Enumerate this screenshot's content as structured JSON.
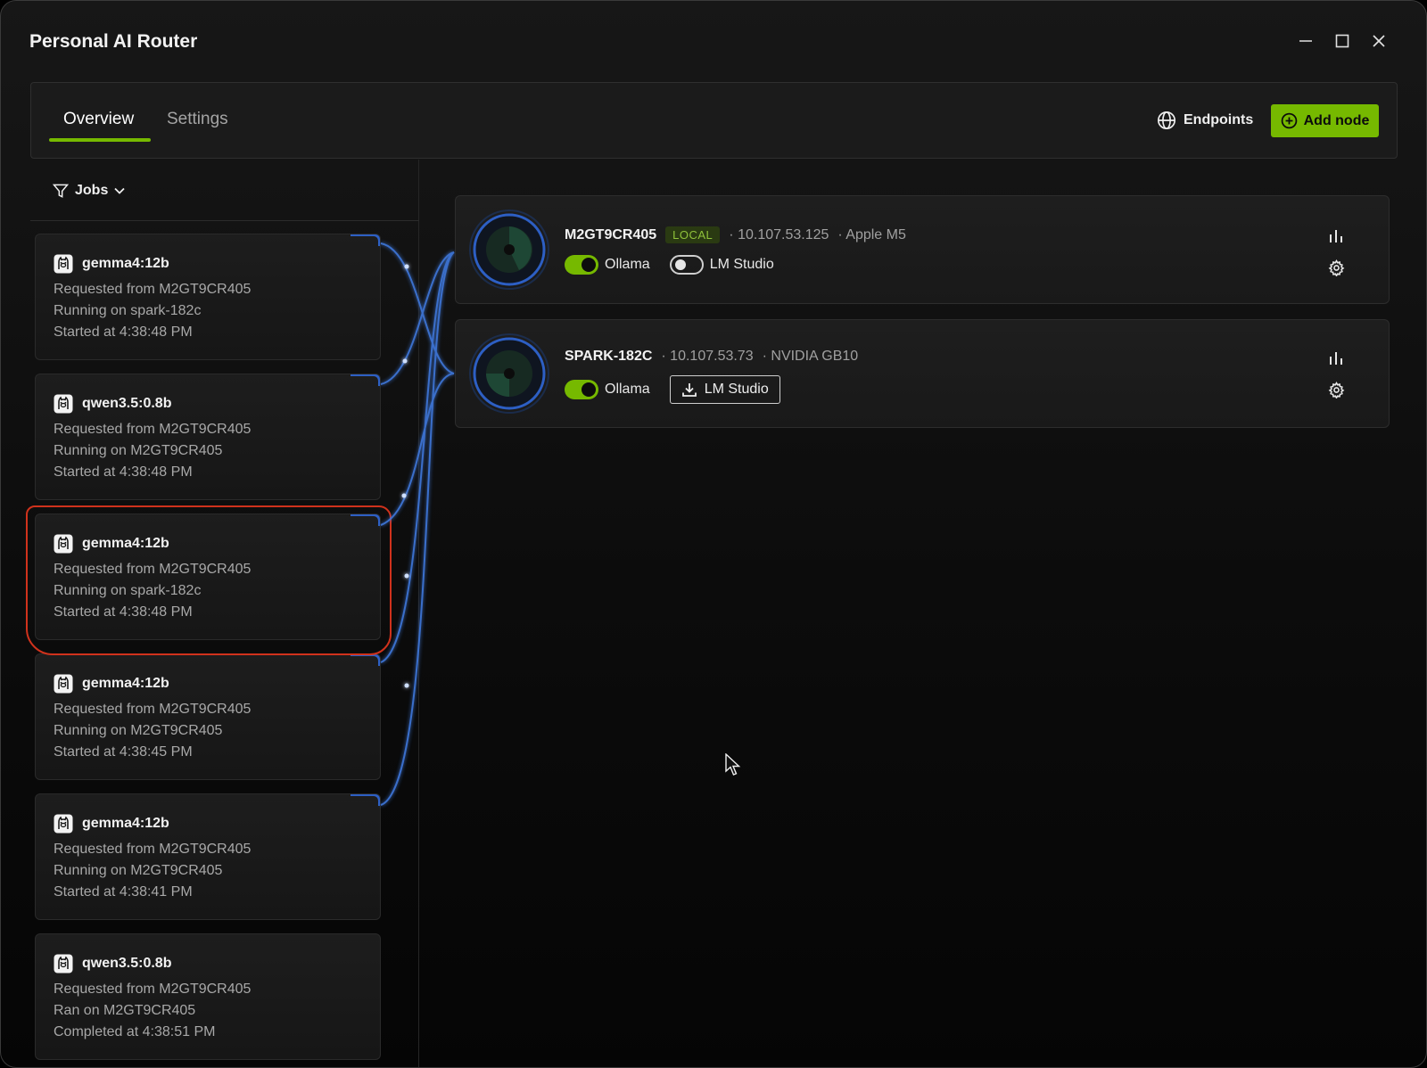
{
  "app": {
    "title": "Personal AI Router"
  },
  "window_controls": {
    "minimize": "minimize-icon",
    "maximize": "maximize-icon",
    "close": "close-icon"
  },
  "tabs": [
    {
      "label": "Overview",
      "active": true
    },
    {
      "label": "Settings",
      "active": false
    }
  ],
  "toolbar": {
    "endpoints_label": "Endpoints",
    "add_node_label": "Add node"
  },
  "jobs_filter": {
    "label": "Jobs"
  },
  "jobs": [
    {
      "model": "gemma4:12b",
      "requested": "Requested from M2GT9CR405",
      "running": "Running on spark-182c",
      "time": "Started at 4:38:48 PM"
    },
    {
      "model": "qwen3.5:0.8b",
      "requested": "Requested from M2GT9CR405",
      "running": "Running on M2GT9CR405",
      "time": "Started at 4:38:48 PM"
    },
    {
      "model": "gemma4:12b",
      "requested": "Requested from M2GT9CR405",
      "running": "Running on spark-182c",
      "time": "Started at 4:38:48 PM"
    },
    {
      "model": "gemma4:12b",
      "requested": "Requested from M2GT9CR405",
      "running": "Running on M2GT9CR405",
      "time": "Started at 4:38:45 PM"
    },
    {
      "model": "gemma4:12b",
      "requested": "Requested from M2GT9CR405",
      "running": "Running on M2GT9CR405",
      "time": "Started at 4:38:41 PM"
    },
    {
      "model": "qwen3.5:0.8b",
      "requested": "Requested from M2GT9CR405",
      "running": "Ran on M2GT9CR405",
      "time": "Completed at 4:38:51 PM"
    }
  ],
  "nodes": [
    {
      "name": "M2GT9CR405",
      "badge": "LOCAL",
      "ip": "· 10.107.53.125",
      "hw": "· Apple M5",
      "services": [
        {
          "label": "Ollama",
          "state": "on"
        },
        {
          "label": "LM Studio",
          "state": "off"
        }
      ]
    },
    {
      "name": "SPARK-182C",
      "badge": "",
      "ip": "· 10.107.53.73",
      "hw": "· NVIDIA GB10",
      "services": [
        {
          "label": "Ollama",
          "state": "on"
        },
        {
          "label": "LM Studio",
          "state": "download"
        }
      ]
    }
  ],
  "colors": {
    "accent": "#76b900",
    "connection": "#3f7ae0",
    "highlight": "#d0321c",
    "background": "#0c0c0c"
  }
}
